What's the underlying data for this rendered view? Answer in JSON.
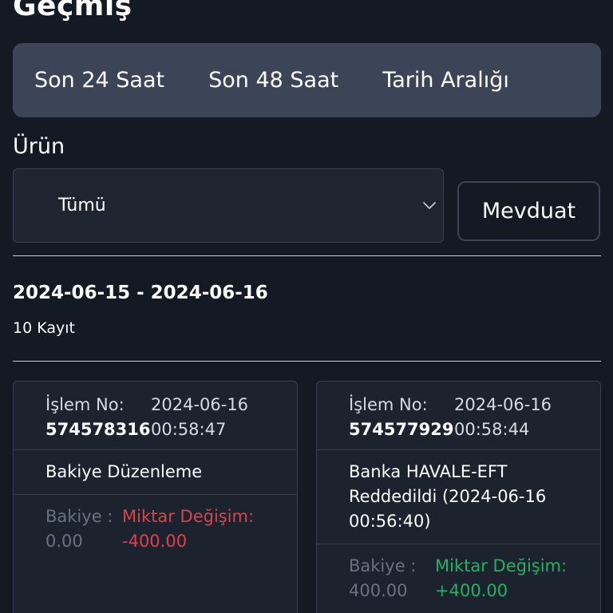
{
  "header": {
    "title": "Geçmiş"
  },
  "tabs": [
    {
      "label": "Son 24 Saat"
    },
    {
      "label": "Son 48 Saat"
    },
    {
      "label": "Tarih Aralığı"
    }
  ],
  "filter": {
    "product_label": "Ürün",
    "product_value": "Tümü",
    "deposit_label": "Mevduat"
  },
  "results": {
    "date_range": "2024-06-15 - 2024-06-16",
    "count": "10 Kayıt"
  },
  "transactions": [
    {
      "id_label": "İşlem No:",
      "id": "574578316",
      "date": "2024-06-16",
      "time": "00:58:47",
      "description": "Bakiye Düzenleme",
      "balance_label": "Bakiye :",
      "balance": "0.00",
      "change_label": "Miktar Değişim:",
      "change": "-400.00"
    },
    {
      "id_label": "İşlem No:",
      "id": "574577929",
      "date": "2024-06-16",
      "time": "00:58:44",
      "description": "Banka HAVALE-EFT Reddedildi (2024-06-16 00:56:40)",
      "balance_label": "Bakiye :",
      "balance": "400.00",
      "change_label": "Miktar Değişim:",
      "change": "+400.00"
    }
  ],
  "colors": {
    "background": "#141a23",
    "tabs_bg": "#3c4558",
    "card_bg": "#1c232f",
    "negative": "#d9434a",
    "positive": "#23b25f",
    "muted": "#687183"
  },
  "icons": {
    "select_chevron": "chevron-down-icon"
  }
}
